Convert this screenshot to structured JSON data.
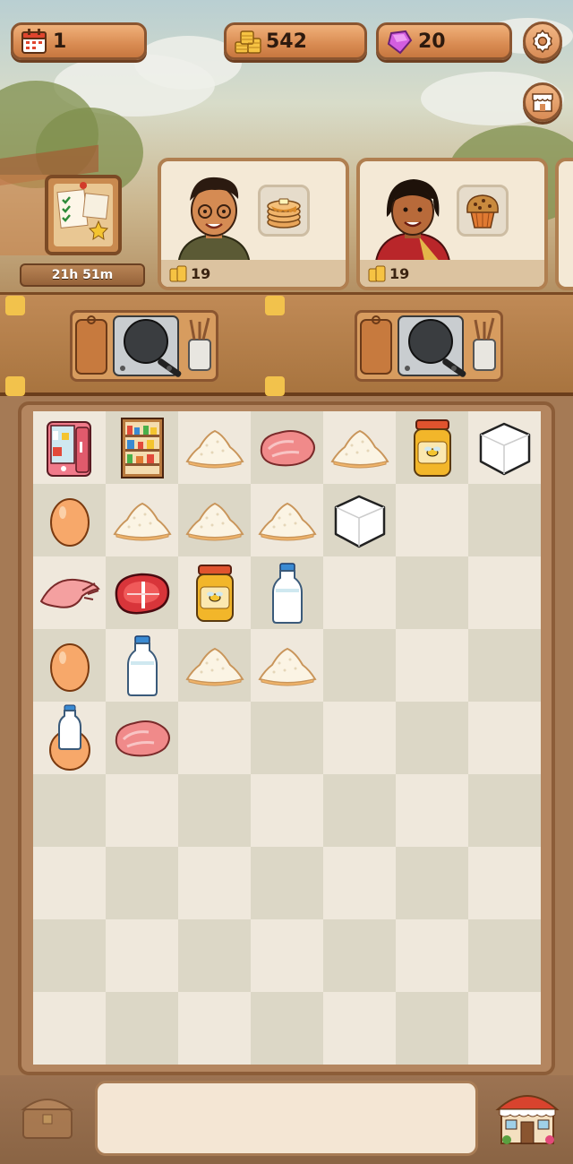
{
  "top_bar": {
    "calendar": {
      "icon": "calendar-icon",
      "value": "1"
    },
    "coins": {
      "icon": "coins-icon",
      "value": "542"
    },
    "gems": {
      "icon": "gem-icon",
      "value": "20"
    },
    "settings_icon": "gear-icon",
    "shop_icon": "shop-icon"
  },
  "orders": {
    "board_icon": "order-board-icon",
    "timer": "21h 51m",
    "customers": [
      {
        "request": "pancakes",
        "reward": "19"
      },
      {
        "request": "muffin",
        "reward": "19"
      }
    ]
  },
  "stations": [
    {
      "name": "frying-pan-station"
    },
    {
      "name": "frying-pan-station"
    }
  ],
  "grid": {
    "columns": 7,
    "rows": 9,
    "items": [
      [
        "fridge",
        "pantry-shelf",
        "flour",
        "meat",
        "flour",
        "honey-jar",
        "sugar-cube"
      ],
      [
        "egg",
        "flour",
        "flour",
        "flour",
        "sugar-cube",
        "",
        ""
      ],
      [
        "chicken-wing",
        "steak",
        "honey-jar",
        "milk",
        "",
        "",
        ""
      ],
      [
        "egg",
        "milk",
        "flour",
        "flour",
        "",
        "",
        ""
      ],
      [
        "egg-milk",
        "meat",
        "",
        "",
        "",
        "",
        ""
      ],
      [
        "",
        "",
        "",
        "",
        "",
        "",
        ""
      ],
      [
        "",
        "",
        "",
        "",
        "",
        "",
        ""
      ],
      [
        "",
        "",
        "",
        "",
        "",
        "",
        ""
      ],
      [
        "",
        "",
        "",
        "",
        "",
        "",
        ""
      ]
    ]
  },
  "bottom": {
    "storage_icon": "chest-icon",
    "restaurant_icon": "restaurant-icon"
  },
  "colors": {
    "accent": "#d98b52",
    "wood": "#a8743f",
    "gem": "#c64bd6",
    "coin": "#f2c24c"
  }
}
